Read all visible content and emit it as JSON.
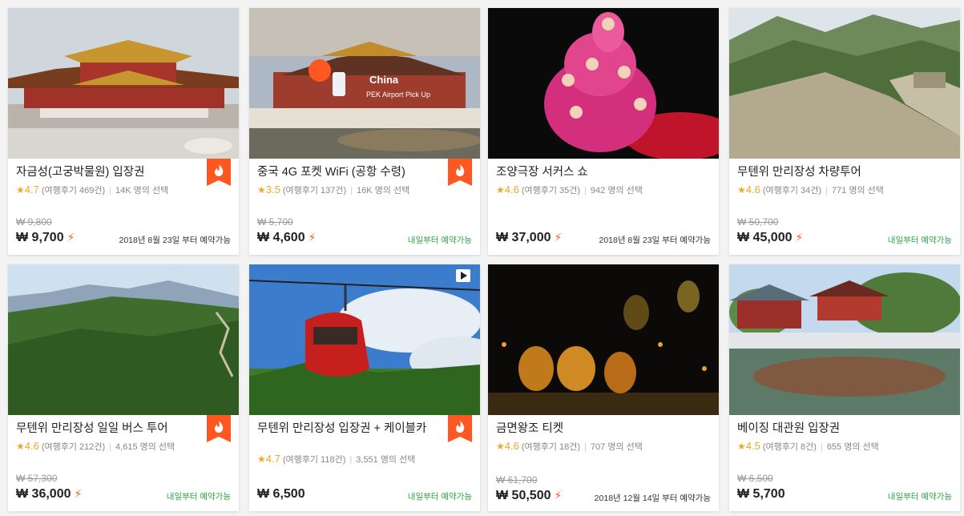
{
  "cards": [
    {
      "title": "자금성(고궁박물원) 입장권",
      "score": "4.7",
      "reviews": "(여행후기 469건)",
      "selected": "14K 명의 선택",
      "old_price": "₩ 9,800",
      "price": "₩ 9,700",
      "available": "2018년 8월 23일 부터 예약가능",
      "hot": true,
      "instant": true
    },
    {
      "title": "중국 4G 포켓 WiFi (공항 수령)",
      "score": "3.5",
      "reviews": "(여행후기 137건)",
      "selected": "16K 명의 선택",
      "old_price": "₩ 5,700",
      "price": "₩ 4,600",
      "available": "내일부터 예약가능",
      "hot": true,
      "instant": true,
      "overlay_title": "China",
      "overlay_sub": "PEK Airport Pick Up"
    },
    {
      "title": "조양극장 서커스 쇼",
      "score": "4.6",
      "reviews": "(여행후기 35건)",
      "selected": "942 명의 선택",
      "old_price": "",
      "price": "₩ 37,000",
      "available": "2018년 8월 23일 부터 예약가능",
      "hot": false,
      "instant": true
    },
    {
      "title": "무텐위 만리장성 차량투어",
      "score": "4.6",
      "reviews": "(여행후기 34건)",
      "selected": "771 명의 선택",
      "old_price": "₩ 50,700",
      "price": "₩ 45,000",
      "available": "내일부터 예약가능",
      "hot": false,
      "instant": true
    },
    {
      "title": "무텐위 만리장성 일일 버스 투어",
      "score": "4.6",
      "reviews": "(여행후기 212건)",
      "selected": "4,615 명의 선택",
      "old_price": "₩ 57,300",
      "price": "₩ 36,000",
      "available": "내일부터 예약가능",
      "hot": true,
      "instant": true
    },
    {
      "title": "무텐위 만리장성 입장권 + 케이블카",
      "score": "4.7",
      "reviews": "(여행후기 118건)",
      "selected": "3,551 명의 선택",
      "old_price": "",
      "price": "₩ 6,500",
      "available": "내일부터 예약가능",
      "hot": true,
      "instant": false
    },
    {
      "title": "금면왕조 티켓",
      "score": "4.6",
      "reviews": "(여행후기 18건)",
      "selected": "707 명의 선택",
      "old_price": "₩ 61,700",
      "price": "₩ 50,500",
      "available": "2018년 12월 14일 부터 예약가능",
      "hot": false,
      "instant": true
    },
    {
      "title": "베이징 대관원 입장권",
      "score": "4.5",
      "reviews": "(여행후기 8건)",
      "selected": "655 명의 선택",
      "old_price": "₩ 6,500",
      "price": "₩ 5,700",
      "available": "내일부터 예약가능",
      "hot": false,
      "instant": false
    }
  ],
  "colors": {
    "hot_badge": "#ff5722",
    "star": "#f5a623",
    "available_green": "#28a745",
    "price": "#222222"
  },
  "icons": {
    "hot": "fire-icon",
    "instant": "lightning-icon",
    "star": "star-icon",
    "video": "play-icon"
  }
}
